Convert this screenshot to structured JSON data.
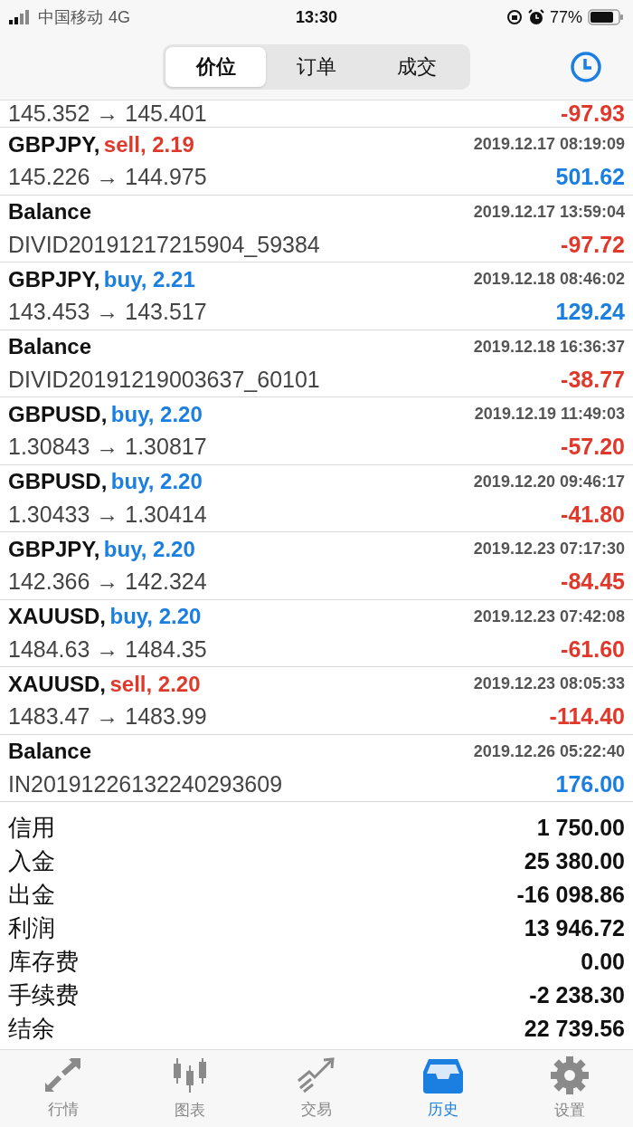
{
  "status_bar": {
    "carrier": "中国移动",
    "network": "4G",
    "time": "13:30",
    "battery": "77%"
  },
  "tabs": [
    {
      "label": "价位",
      "selected": true
    },
    {
      "label": "订单",
      "selected": false
    },
    {
      "label": "成交",
      "selected": false
    }
  ],
  "partial_row": {
    "prices": "145.352 → 145.401",
    "profit": {
      "text": "-97.93",
      "color": "#e0392b"
    }
  },
  "deals": [
    {
      "kind": "trade",
      "symbol": "GBPJPY,",
      "side": {
        "text": "sell, 2.19",
        "color": "#e0392b"
      },
      "time": "2019.12.17 08:19:09",
      "detail": "145.226 → 144.975",
      "profit": {
        "text": "501.62",
        "color": "#1a7fe0"
      }
    },
    {
      "kind": "balance",
      "symbol": "Balance",
      "time": "2019.12.17 13:59:04",
      "detail": "DIVID20191217215904_59384",
      "profit": {
        "text": "-97.72",
        "color": "#e0392b"
      }
    },
    {
      "kind": "trade",
      "symbol": "GBPJPY,",
      "side": {
        "text": "buy, 2.21",
        "color": "#1a7fe0"
      },
      "time": "2019.12.18 08:46:02",
      "detail": "143.453 → 143.517",
      "profit": {
        "text": "129.24",
        "color": "#1a7fe0"
      }
    },
    {
      "kind": "balance",
      "symbol": "Balance",
      "time": "2019.12.18 16:36:37",
      "detail": "DIVID20191219003637_60101",
      "profit": {
        "text": "-38.77",
        "color": "#e0392b"
      }
    },
    {
      "kind": "trade",
      "symbol": "GBPUSD,",
      "side": {
        "text": "buy, 2.20",
        "color": "#1a7fe0"
      },
      "time": "2019.12.19 11:49:03",
      "detail": "1.30843 → 1.30817",
      "profit": {
        "text": "-57.20",
        "color": "#e0392b"
      }
    },
    {
      "kind": "trade",
      "symbol": "GBPUSD,",
      "side": {
        "text": "buy, 2.20",
        "color": "#1a7fe0"
      },
      "time": "2019.12.20 09:46:17",
      "detail": "1.30433 → 1.30414",
      "profit": {
        "text": "-41.80",
        "color": "#e0392b"
      }
    },
    {
      "kind": "trade",
      "symbol": "GBPJPY,",
      "side": {
        "text": "buy, 2.20",
        "color": "#1a7fe0"
      },
      "time": "2019.12.23 07:17:30",
      "detail": "142.366 → 142.324",
      "profit": {
        "text": "-84.45",
        "color": "#e0392b"
      }
    },
    {
      "kind": "trade",
      "symbol": "XAUUSD,",
      "side": {
        "text": "buy, 2.20",
        "color": "#1a7fe0"
      },
      "time": "2019.12.23 07:42:08",
      "detail": "1484.63 → 1484.35",
      "profit": {
        "text": "-61.60",
        "color": "#e0392b"
      }
    },
    {
      "kind": "trade",
      "symbol": "XAUUSD,",
      "side": {
        "text": "sell, 2.20",
        "color": "#e0392b"
      },
      "time": "2019.12.23 08:05:33",
      "detail": "1483.47 → 1483.99",
      "profit": {
        "text": "-114.40",
        "color": "#e0392b"
      }
    },
    {
      "kind": "balance",
      "symbol": "Balance",
      "time": "2019.12.26 05:22:40",
      "detail": "IN20191226132240293609",
      "profit": {
        "text": "176.00",
        "color": "#1a7fe0"
      }
    }
  ],
  "summary": [
    {
      "label": "信用",
      "value": "1 750.00"
    },
    {
      "label": "入金",
      "value": "25 380.00"
    },
    {
      "label": "出金",
      "value": "-16 098.86"
    },
    {
      "label": "利润",
      "value": "13 946.72"
    },
    {
      "label": "库存费",
      "value": "0.00"
    },
    {
      "label": "手续费",
      "value": "-2 238.30"
    },
    {
      "label": "结余",
      "value": "22 739.56"
    }
  ],
  "nav": [
    {
      "kind": "quotes",
      "label": "行情",
      "selected": false
    },
    {
      "kind": "chart",
      "label": "图表",
      "selected": false
    },
    {
      "kind": "trade",
      "label": "交易",
      "selected": false
    },
    {
      "kind": "history",
      "label": "历史",
      "selected": true
    },
    {
      "kind": "settings",
      "label": "设置",
      "selected": false
    }
  ]
}
